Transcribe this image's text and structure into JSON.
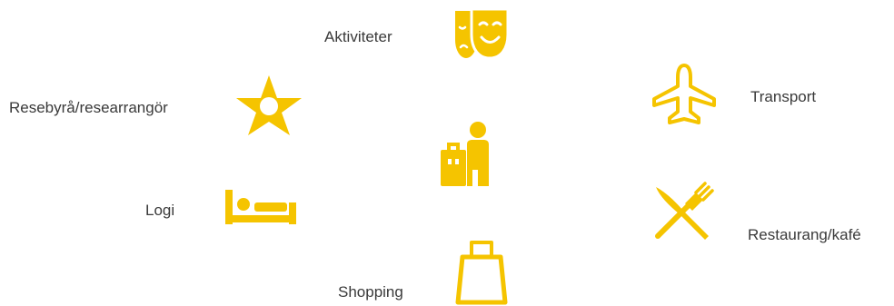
{
  "accent_color": "#F5C400",
  "center": {
    "icon": "traveler-with-luggage-icon"
  },
  "categories": {
    "activities": {
      "label": "Aktiviteter",
      "icon": "theater-masks-icon"
    },
    "travel_agency": {
      "label": "Resebyrå/researrangör",
      "icon": "star-icon"
    },
    "transport": {
      "label": "Transport",
      "icon": "airplane-icon"
    },
    "lodging": {
      "label": "Logi",
      "icon": "bed-icon"
    },
    "restaurant": {
      "label": "Restaurang/kafé",
      "icon": "knife-fork-icon"
    },
    "shopping": {
      "label": "Shopping",
      "icon": "shopping-bag-icon"
    }
  }
}
